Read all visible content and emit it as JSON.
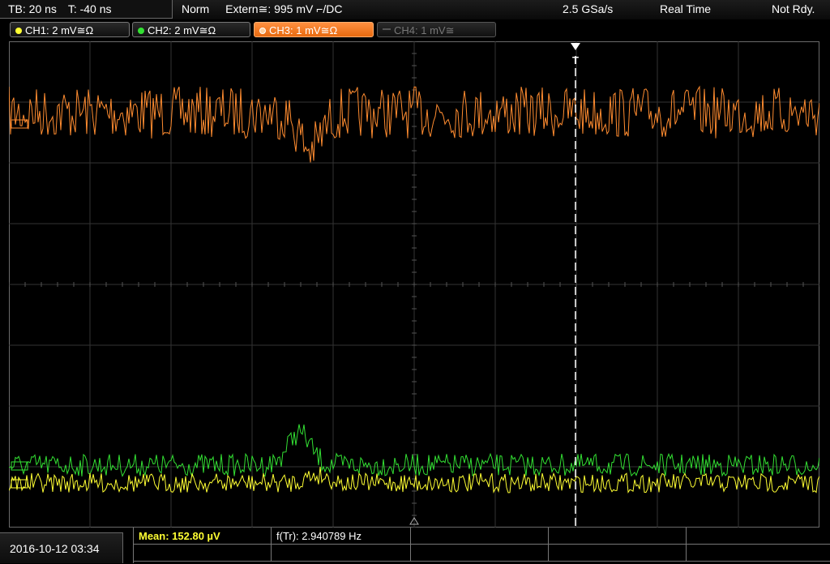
{
  "topbar": {
    "timebase": "TB: 20 ns",
    "trigger_time": "T: -40 ns",
    "trigger_mode": "Norm",
    "trigger_source": "Extern≅: 995 mV ⌐/DC",
    "sample_rate": "2.5 GSa/s",
    "acq_mode": "Real Time",
    "status": "Not Rdy."
  },
  "channels": [
    {
      "label": "CH1: 2 mV≅Ω",
      "color": "#ffff33",
      "active": true
    },
    {
      "label": "CH2: 2 mV≅Ω",
      "color": "#33e033",
      "active": true
    },
    {
      "label": "CH3: 1 mV≅Ω",
      "color": "#ff8c30",
      "active": true,
      "selected": true
    },
    {
      "label": "CH4: 1 mV≅",
      "color": "#777777",
      "active": false
    }
  ],
  "scope": {
    "trigger_marker": "T",
    "traces": {
      "ch3_color": "#ff8c30",
      "ch2_color": "#33e033",
      "ch1_color": "#ffff33"
    }
  },
  "datetime": "2016-10-12 03:34",
  "measurements": {
    "mean": "Mean: 152.80 µV",
    "frequency": "f(Tr): 2.940789 Hz"
  }
}
